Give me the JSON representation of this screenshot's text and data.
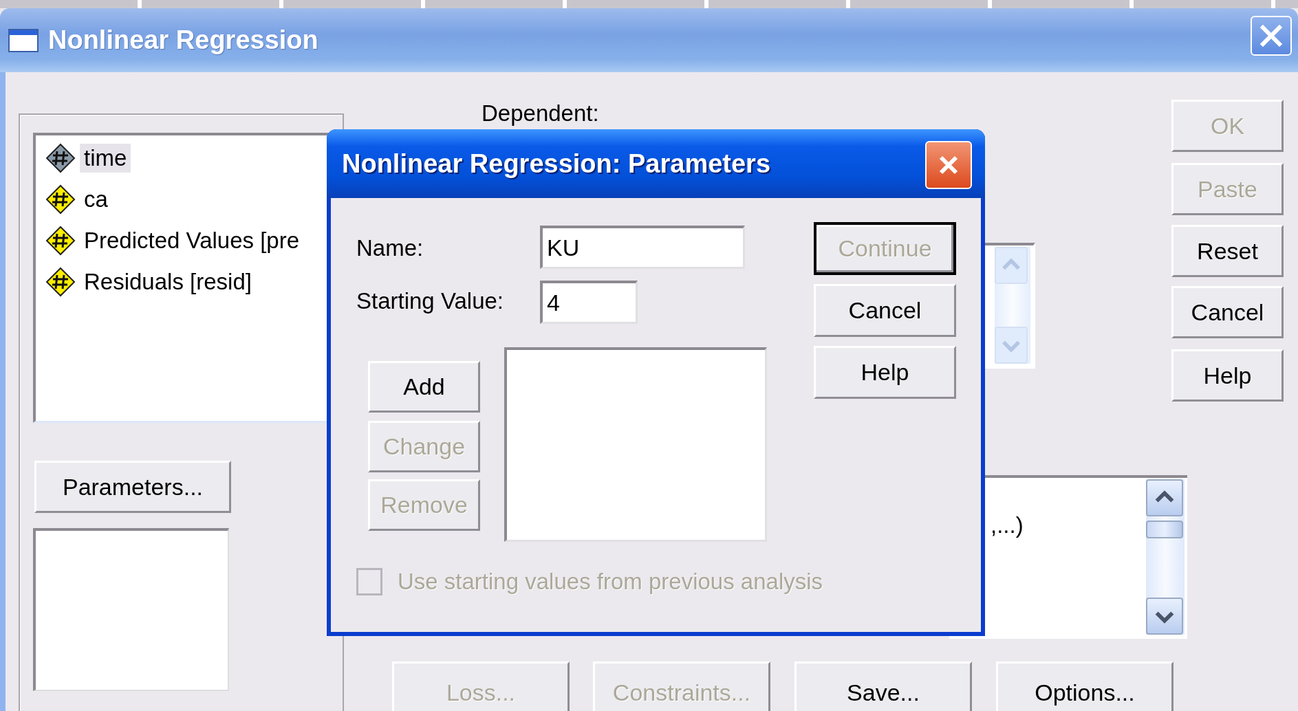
{
  "main_window": {
    "title": "Nonlinear Regression",
    "variables": [
      {
        "label": "time",
        "selected": true
      },
      {
        "label": "ca",
        "selected": false
      },
      {
        "label": "Predicted Values [pre",
        "selected": false
      },
      {
        "label": "Residuals [resid]",
        "selected": false
      }
    ],
    "dependent_label": "Dependent:",
    "parameters_button": {
      "label": "Parameters...",
      "disabled": false
    },
    "model_expression_fragment": ",...)",
    "side_buttons": [
      {
        "label": "OK",
        "disabled": true
      },
      {
        "label": "Paste",
        "disabled": true
      },
      {
        "label": "Reset",
        "disabled": false
      },
      {
        "label": "Cancel",
        "disabled": false
      },
      {
        "label": "Help",
        "disabled": false
      }
    ],
    "bottom_buttons": [
      {
        "label": "Loss...",
        "disabled": true
      },
      {
        "label": "Constraints...",
        "disabled": true
      },
      {
        "label": "Save...",
        "disabled": false
      },
      {
        "label": "Options...",
        "disabled": false
      }
    ]
  },
  "parameters_dialog": {
    "title": "Nonlinear Regression: Parameters",
    "name_field": {
      "label": "Name:",
      "value": "KU"
    },
    "starting_value_field": {
      "label": "Starting Value:",
      "value": "4"
    },
    "list_buttons": [
      {
        "label": "Add",
        "disabled": false
      },
      {
        "label": "Change",
        "disabled": true
      },
      {
        "label": "Remove",
        "disabled": true
      }
    ],
    "buttons": [
      {
        "label": "Continue",
        "disabled": true,
        "default": true
      },
      {
        "label": "Cancel",
        "disabled": false,
        "default": false
      },
      {
        "label": "Help",
        "disabled": false,
        "default": false
      }
    ],
    "checkbox": {
      "label": "Use starting values from previous analysis",
      "checked": false,
      "disabled": true
    }
  }
}
